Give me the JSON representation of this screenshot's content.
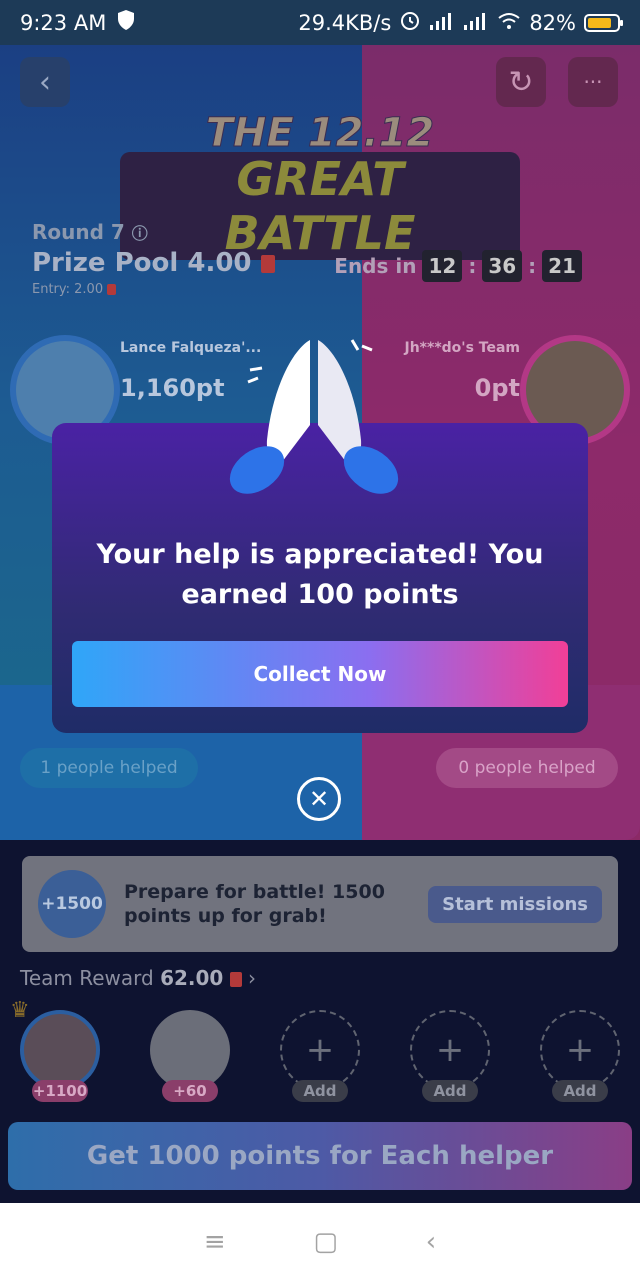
{
  "status_bar": {
    "time": "9:23 AM",
    "speed": "29.4KB/s",
    "battery_percent": "82%",
    "battery_level": 0.82
  },
  "header": {
    "back_icon": "chevron-left-icon",
    "refresh_icon": "refresh-icon",
    "more_icon": "more-icon",
    "title_line1": "THE 12.12",
    "title_line2": "GREAT BATTLE"
  },
  "round_info": {
    "round_label": "Round 7",
    "prize_pool": "Prize Pool 4.00",
    "entry": "Entry: 2.00",
    "ends_label": "Ends in",
    "timer_h": "12",
    "timer_m": "36",
    "timer_s": "21"
  },
  "teams": {
    "left_name": "Lance Falqueza'...",
    "left_points": "1,160pt",
    "right_name": "Jh***do's Team",
    "right_points": "0pt",
    "left_helped": "1 people helped",
    "right_helped": "0 people helped"
  },
  "modal": {
    "message_line1": "Your help is appreciated! You",
    "message_line2": "earned 100 points",
    "collect_label": "Collect Now"
  },
  "mission": {
    "badge": "+1500",
    "text": "Prepare for battle! 1500 points up for grab!",
    "start_label": "Start missions"
  },
  "team_reward": {
    "label": "Team Reward",
    "amount": "62.00"
  },
  "helpers": [
    {
      "label": "+1100"
    },
    {
      "label": "+60"
    },
    {
      "label": "Add"
    },
    {
      "label": "Add"
    },
    {
      "label": "Add"
    }
  ],
  "cta_label": "Get 1000 points for Each helper",
  "nav": {
    "menu_icon": "menu-icon",
    "home_icon": "home-square-icon",
    "back_icon": "back-chevron-icon"
  },
  "colors": {
    "accent_blue": "#2fa6f8",
    "accent_pink": "#f13f97",
    "modal_purple": "#4a22a4"
  }
}
